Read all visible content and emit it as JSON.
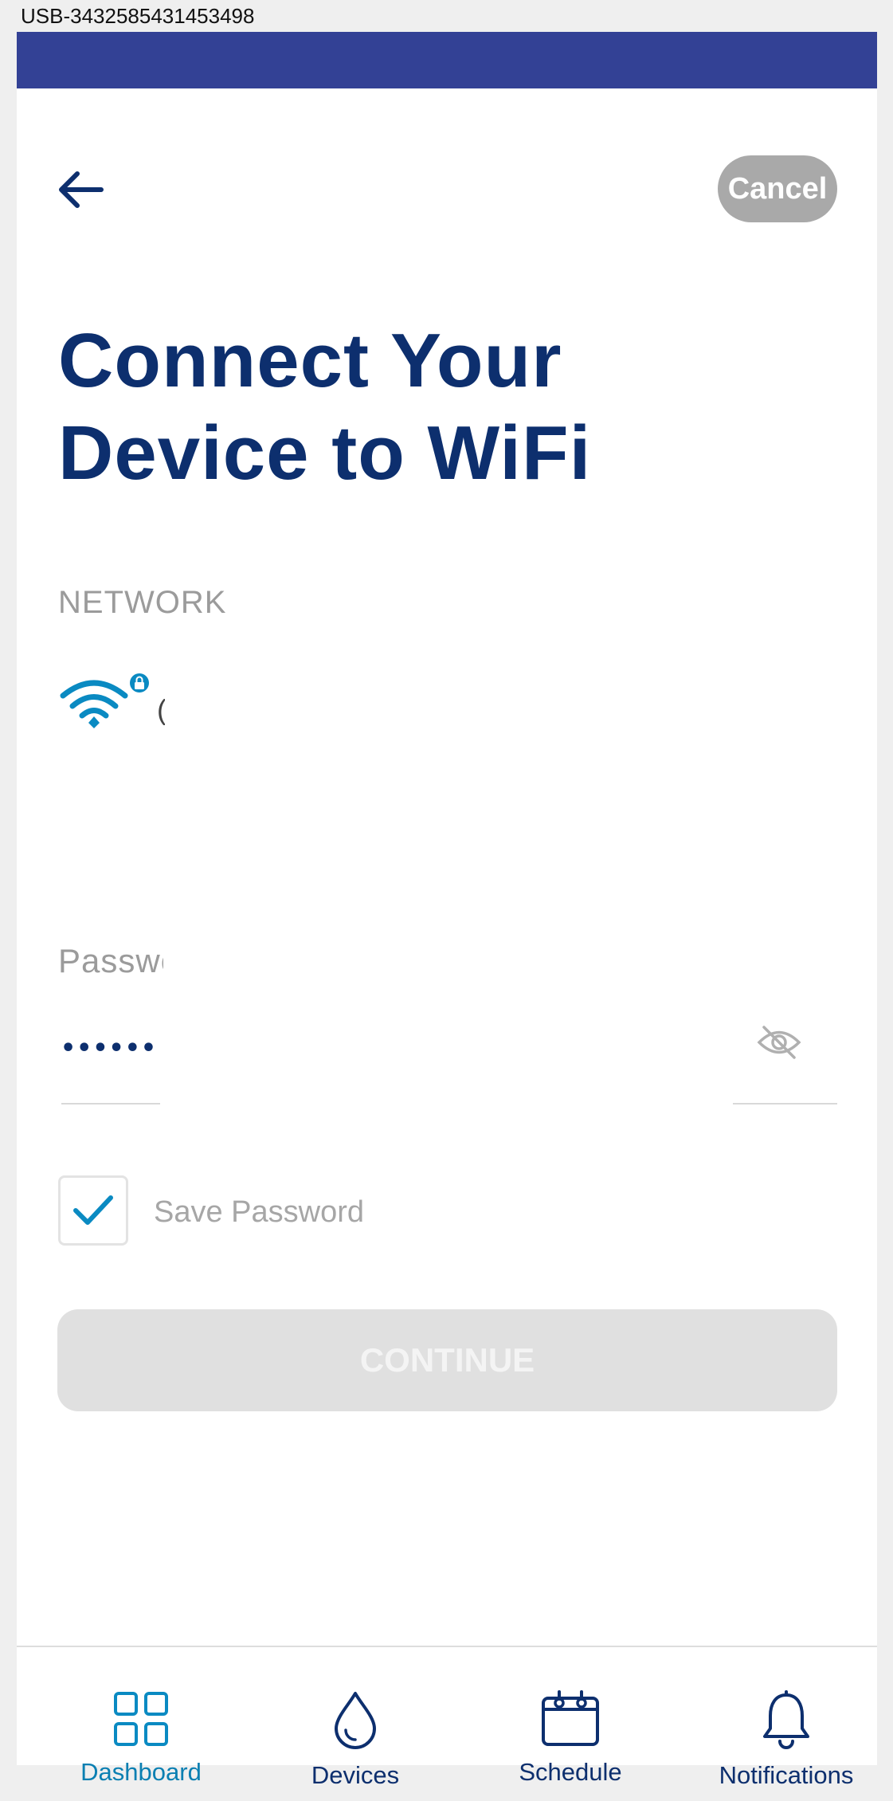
{
  "window": {
    "title": "USB-3432585431453498"
  },
  "header": {
    "cancel_label": "Cancel"
  },
  "page": {
    "title_line1": "Connect Your",
    "title_line2": "Device to WiFi"
  },
  "network": {
    "label": "NETWORK",
    "ssid": "("
  },
  "password": {
    "label": "Password",
    "value": "•••••••"
  },
  "save_password": {
    "label": "Save Password",
    "checked": true
  },
  "continue": {
    "label": "CONTINUE"
  },
  "bottom_nav": {
    "items": [
      {
        "label": "Dashboard",
        "icon": "dashboard-grid-icon",
        "active": true
      },
      {
        "label": "Devices",
        "icon": "water-drop-icon",
        "active": false
      },
      {
        "label": "Schedule",
        "icon": "calendar-icon",
        "active": false
      },
      {
        "label": "Notifications",
        "icon": "bell-icon",
        "active": false
      }
    ]
  },
  "colors": {
    "status_bar": "#334195",
    "title": "#0d2f6e",
    "accent": "#0a7fb2",
    "cancel_bg": "#a9a9a9",
    "continue_disabled": "#e0e0e0"
  }
}
